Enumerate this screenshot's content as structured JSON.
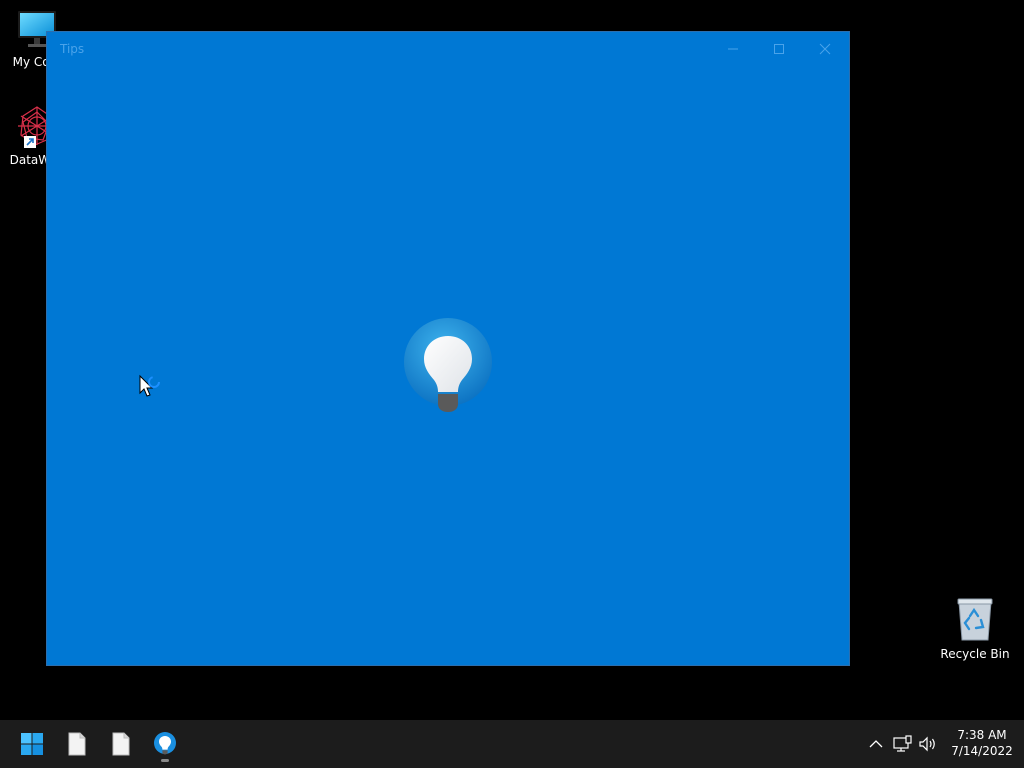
{
  "desktop": {
    "icons": [
      {
        "label": "My Com",
        "icon": "monitor-icon"
      },
      {
        "label": "DataWag",
        "icon": "datawag-app-icon",
        "shortcut": true
      },
      {
        "label": "Recycle Bin",
        "icon": "recycle-bin-icon"
      }
    ]
  },
  "window": {
    "title": "Tips",
    "background_color": "#0078d4",
    "splash_icon": "lightbulb-icon",
    "buttons": [
      "minimize",
      "maximize",
      "close"
    ]
  },
  "taskbar": {
    "items": [
      {
        "icon": "windows-start-icon"
      },
      {
        "icon": "file-icon"
      },
      {
        "icon": "file-icon"
      },
      {
        "icon": "tips-lightbulb-icon",
        "active": true
      }
    ],
    "tray": {
      "icons": [
        "chevron-up-icon",
        "network-icon",
        "volume-icon"
      ],
      "time": "7:38 AM",
      "date": "7/14/2022"
    }
  },
  "cursor": {
    "icon": "busy-cursor-icon"
  }
}
